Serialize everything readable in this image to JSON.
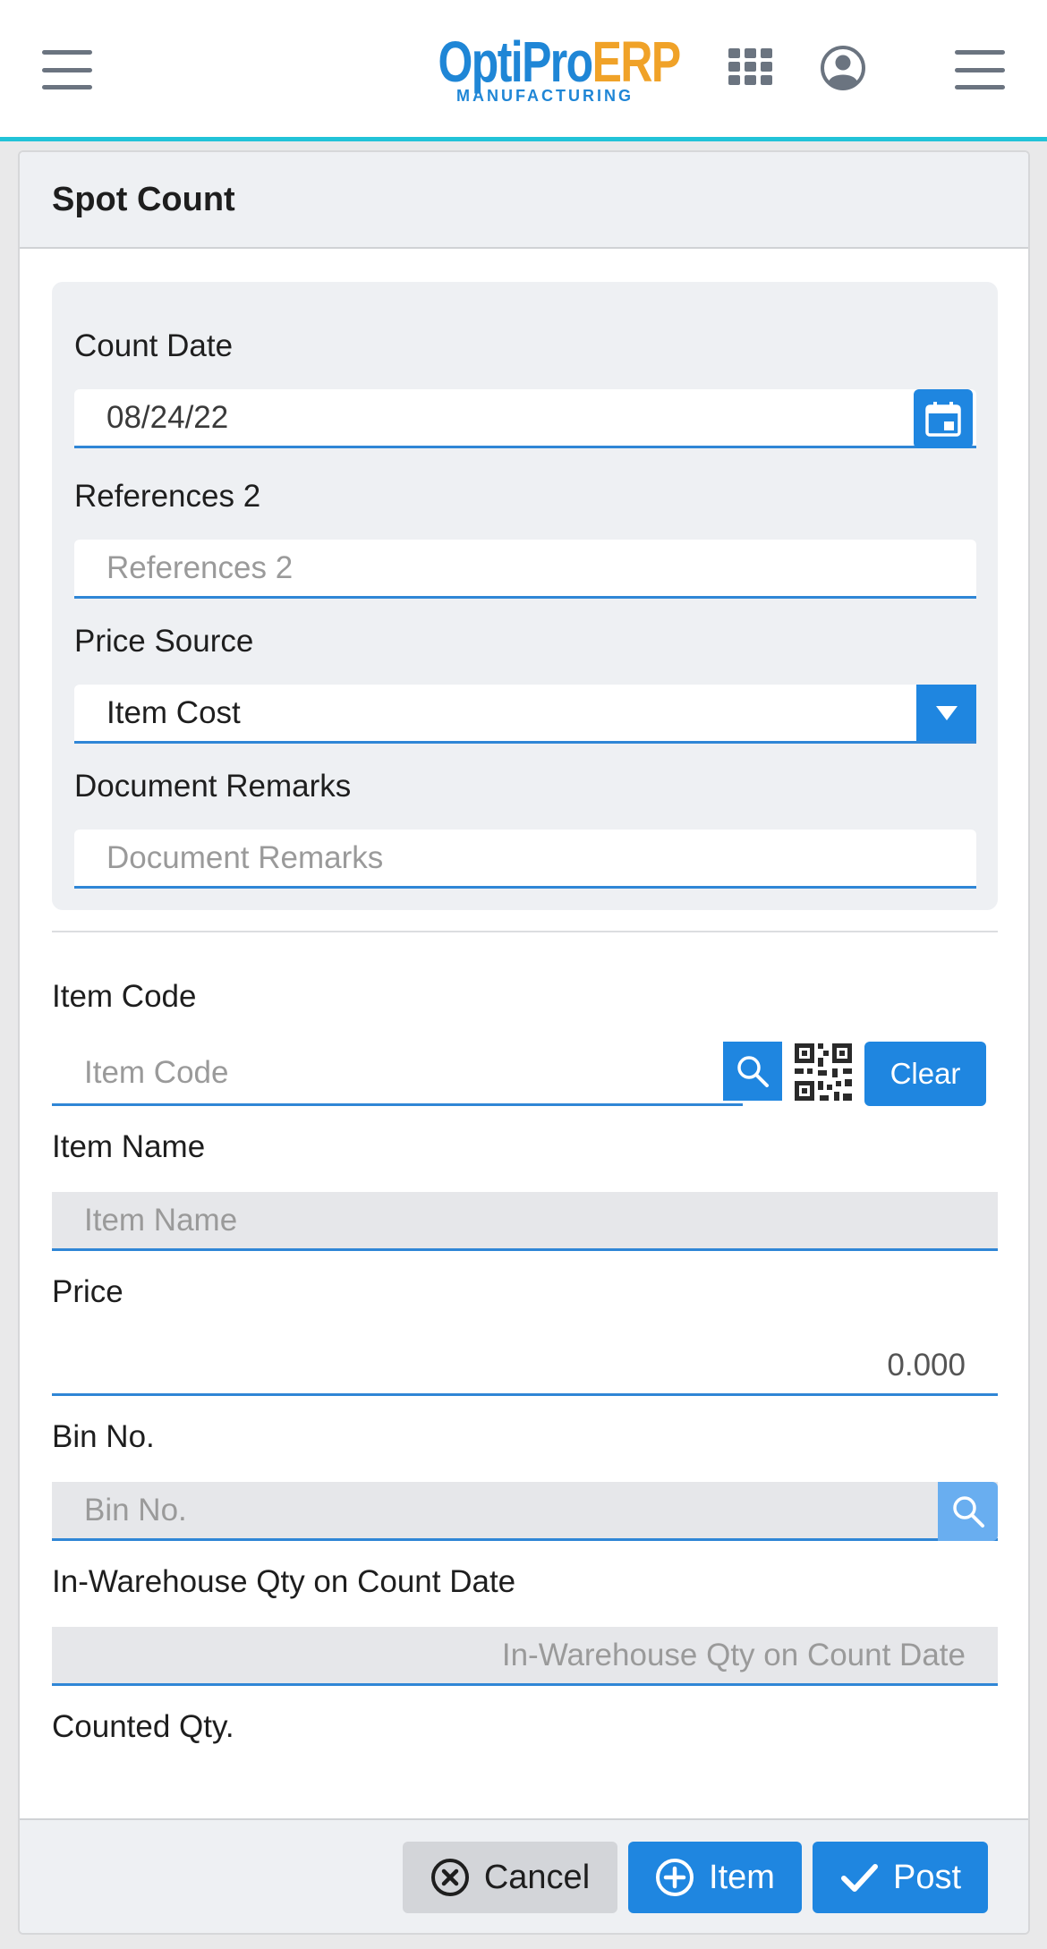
{
  "header": {
    "logo_opti": "OptiPro",
    "logo_erp": "ERP",
    "logo_sub": "MANUFACTURING"
  },
  "page": {
    "title": "Spot Count"
  },
  "form": {
    "count_date": {
      "label": "Count Date",
      "value": "08/24/22"
    },
    "references2": {
      "label": "References 2",
      "placeholder": "References 2"
    },
    "price_source": {
      "label": "Price Source",
      "value": "Item Cost"
    },
    "document_remarks": {
      "label": "Document Remarks",
      "placeholder": "Document Remarks"
    },
    "item_code": {
      "label": "Item Code",
      "placeholder": "Item Code",
      "clear_label": "Clear"
    },
    "item_name": {
      "label": "Item Name",
      "placeholder": "Item Name"
    },
    "price": {
      "label": "Price",
      "value": "0.000"
    },
    "bin_no": {
      "label": "Bin No.",
      "placeholder": "Bin No."
    },
    "in_warehouse_qty": {
      "label": "In-Warehouse Qty on Count Date",
      "placeholder": "In-Warehouse Qty on Count Date"
    },
    "counted_qty": {
      "label": "Counted Qty."
    }
  },
  "footer": {
    "cancel_label": "Cancel",
    "item_label": "Item",
    "post_label": "Post"
  },
  "colors": {
    "accent": "#1f86e0",
    "header_rule": "#22c3d8",
    "logo_blue": "#1f86d6",
    "logo_orange": "#f0a228"
  }
}
